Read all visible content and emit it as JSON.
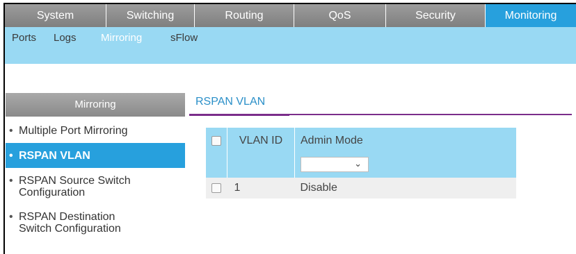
{
  "topnav": {
    "tabs": [
      {
        "label": "System"
      },
      {
        "label": "Switching"
      },
      {
        "label": "Routing"
      },
      {
        "label": "QoS"
      },
      {
        "label": "Security"
      },
      {
        "label": "Monitoring"
      }
    ],
    "active_index": 5
  },
  "subnav": {
    "items": [
      {
        "label": "Ports"
      },
      {
        "label": "Logs"
      },
      {
        "label": "Mirroring"
      },
      {
        "label": "sFlow"
      }
    ],
    "active_index": 2
  },
  "sidebar": {
    "header": "Mirroring",
    "items": [
      {
        "label": "Multiple Port Mirroring"
      },
      {
        "label": "RSPAN VLAN"
      },
      {
        "label": "RSPAN Source Switch Configuration"
      },
      {
        "label": "RSPAN Destination Switch Configuration"
      }
    ],
    "bullet": "•",
    "active_index": 1
  },
  "content": {
    "tab_title": "RSPAN VLAN",
    "table": {
      "columns": [
        "VLAN ID",
        "Admin Mode"
      ],
      "filter": {
        "admin_mode_value": "",
        "chevron": "⌄"
      },
      "rows": [
        {
          "vlan_id": "1",
          "admin_mode": "Disable"
        }
      ]
    }
  },
  "colors": {
    "accent": "#27a0dd",
    "subnav_bg": "#99d9f3",
    "tab_underline": "#7a2d8a"
  }
}
